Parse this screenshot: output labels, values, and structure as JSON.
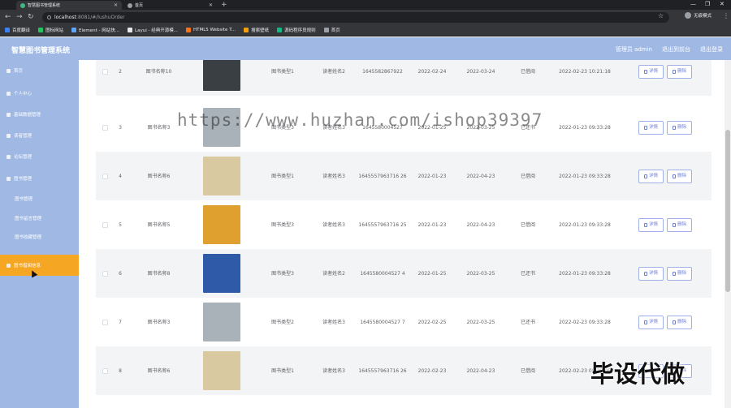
{
  "browser": {
    "tabs": [
      {
        "label": "智慧图书管理系统",
        "active": true,
        "color": "#41b883"
      },
      {
        "label": "首页",
        "active": false,
        "color": "#9aa0a6"
      }
    ],
    "url_host": "localhost",
    "url_rest": ":8081/#/lushuOrder",
    "profile_label": "无痕模式",
    "bookmarks": [
      {
        "label": "百度翻译",
        "color": "#3b82f6"
      },
      {
        "label": "图标网站",
        "color": "#22c55e"
      },
      {
        "label": "Element - 网站快...",
        "color": "#60a5fa"
      },
      {
        "label": "Layui - 经典开源模...",
        "color": "#e5e7eb"
      },
      {
        "label": "HTML5 Website T...",
        "color": "#f97316"
      },
      {
        "label": "搜索壁纸",
        "color": "#f59e0b"
      },
      {
        "label": "源码程序员规则",
        "color": "#10b981"
      },
      {
        "label": "首页",
        "color": "#9aa0a6"
      }
    ]
  },
  "header": {
    "title": "智慧图书管理系统",
    "links": [
      "管理员 admin",
      "退出到前台",
      "退出登录"
    ]
  },
  "sidebar": {
    "items": [
      {
        "label": "首页",
        "type": "item"
      },
      {
        "label": "个人中心",
        "type": "item"
      },
      {
        "label": "基础数据管理",
        "type": "item"
      },
      {
        "label": "读者管理",
        "type": "item"
      },
      {
        "label": "论坛管理",
        "type": "item"
      },
      {
        "label": "图书管理",
        "type": "item"
      },
      {
        "label": "图书管理",
        "type": "sub"
      },
      {
        "label": "图书留言管理",
        "type": "sub"
      },
      {
        "label": "图书收藏管理",
        "type": "sub"
      },
      {
        "label": "图书借阅信息",
        "type": "item",
        "active": true
      }
    ]
  },
  "actions": {
    "detail_label": "详情",
    "delete_label": "删除"
  },
  "rows": [
    {
      "index": "2",
      "book": "图书名称10",
      "type": "图书类型1",
      "reader": "读者姓名2",
      "order_no": "1645582867922",
      "borrow_date": "2022-02-24",
      "return_date": "2022-03-24",
      "status": "已借阅",
      "created": "2022-02-23 10:21:18",
      "cover": "#3a3f44"
    },
    {
      "index": "3",
      "book": "图书名称3",
      "type": "图书类型3",
      "reader": "读者姓名3",
      "order_no": "1645580004527",
      "borrow_date": "2022-01-25",
      "return_date": "2022-03-25",
      "status": "已还书",
      "created": "2022-01-23 09:33:28",
      "cover": "#a9b2b8"
    },
    {
      "index": "4",
      "book": "图书名称6",
      "type": "图书类型1",
      "reader": "读者姓名3",
      "order_no": "1645557963716 26",
      "borrow_date": "2022-01-23",
      "return_date": "2022-04-23",
      "status": "已借阅",
      "created": "2022-01-23 09:33:28",
      "cover": "#d8c9a0"
    },
    {
      "index": "5",
      "book": "图书名称5",
      "type": "图书类型3",
      "reader": "读者姓名3",
      "order_no": "1645557963716 25",
      "borrow_date": "2022-01-23",
      "return_date": "2022-04-23",
      "status": "已借阅",
      "created": "2022-01-23 09:33:28",
      "cover": "#e0a030"
    },
    {
      "index": "6",
      "book": "图书名称8",
      "type": "图书类型3",
      "reader": "读者姓名2",
      "order_no": "1645580004527 4",
      "borrow_date": "2022-01-25",
      "return_date": "2022-03-25",
      "status": "已还书",
      "created": "2022-01-23 09:33:28",
      "cover": "#2e5aa8"
    },
    {
      "index": "7",
      "book": "图书名称3",
      "type": "图书类型2",
      "reader": "读者姓名3",
      "order_no": "1645580004527 7",
      "borrow_date": "2022-02-25",
      "return_date": "2022-03-25",
      "status": "已还书",
      "created": "2022-02-23 09:33:28",
      "cover": "#a9b2b8"
    },
    {
      "index": "8",
      "book": "图书名称6",
      "type": "图书类型1",
      "reader": "读者姓名3",
      "order_no": "1645557963716 26",
      "borrow_date": "2022-02-23",
      "return_date": "2022-04-23",
      "status": "已借阅",
      "created": "2022-02-23 09:29:06",
      "cover": "#d8c9a0"
    }
  ],
  "overlays": {
    "watermark": "https://www.huzhan.com/ishop39397",
    "stamp": "毕设代做"
  }
}
